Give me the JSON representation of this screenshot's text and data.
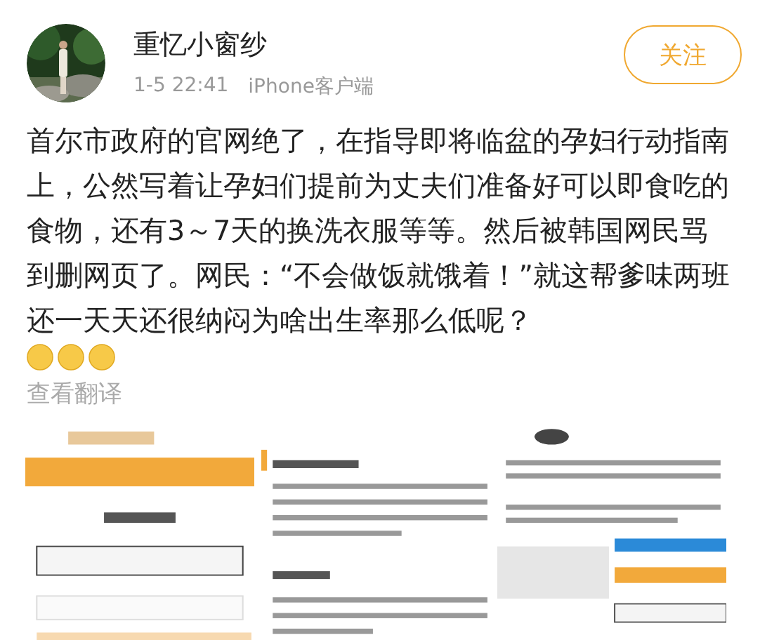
{
  "post": {
    "author": "重忆小窗纱",
    "date": "1-5 22:41",
    "source": "iPhone客户端",
    "follow_button": "关注",
    "text": "首尔市政府的官网绝了，在指导即将临盆的孕妇行动指南上，公然写着让孕妇们提前为丈夫们准备好可以即食吃的食物，还有3～7天的换洗衣服等等。然后被韩国网民骂到删网页了。网民：“不会做饭就饿着！”就这帮爹味两班还一天天还很纳闷为啥出生率那么低呢？",
    "translate_link": "查看翻译"
  }
}
